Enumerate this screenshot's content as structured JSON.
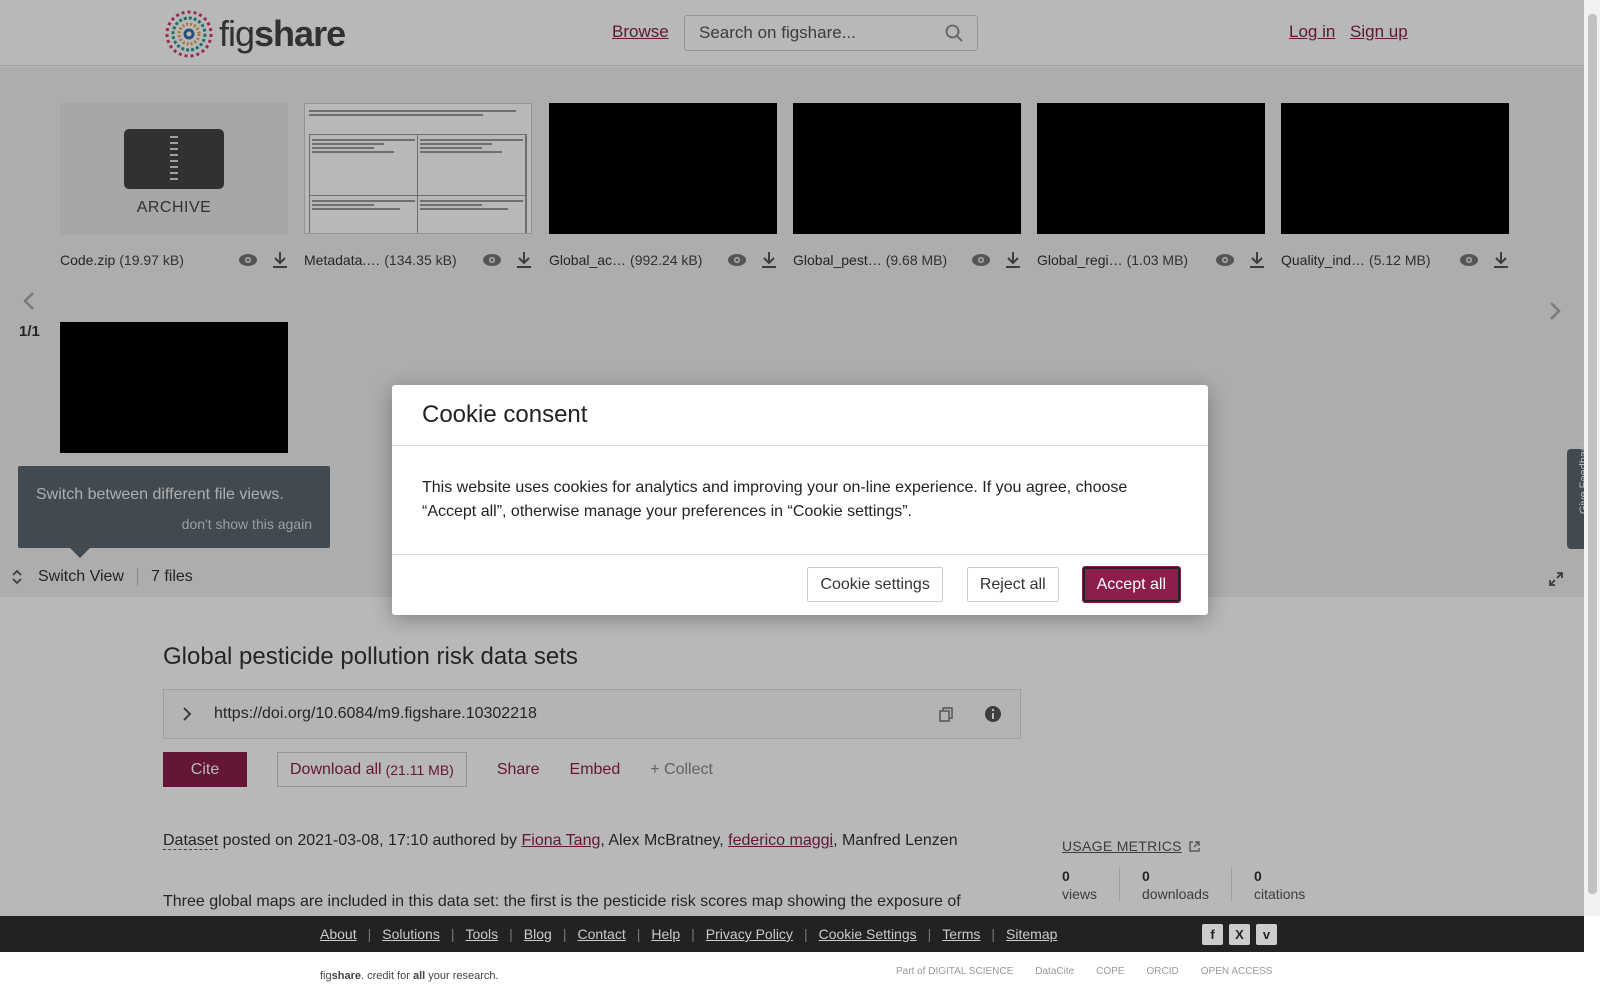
{
  "header": {
    "logo_text_a": "fig",
    "logo_text_b": "share",
    "browse": "Browse",
    "search_placeholder": "Search on figshare...",
    "login": "Log in",
    "signup": "Sign up"
  },
  "viewer": {
    "files": [
      {
        "name": "Code.zip",
        "size": "(19.97 kB)",
        "thumb": "archive",
        "label": "ARCHIVE"
      },
      {
        "name": "Metadata.…",
        "size": "(134.35 kB)",
        "thumb": "doc"
      },
      {
        "name": "Global_ac…",
        "size": "(992.24 kB)",
        "thumb": "black"
      },
      {
        "name": "Global_pest…",
        "size": "(9.68 MB)",
        "thumb": "black"
      },
      {
        "name": "Global_regi…",
        "size": "(1.03 MB)",
        "thumb": "black"
      },
      {
        "name": "Quality_ind…",
        "size": "(5.12 MB)",
        "thumb": "black"
      }
    ],
    "pager": "1/1",
    "tooltip_message": "Switch between different file views.",
    "tooltip_dismiss": "don't show this again",
    "switch_view": "Switch View",
    "file_count": "7 files"
  },
  "item": {
    "title": "Global pesticide pollution risk data sets",
    "doi": "https://doi.org/10.6084/m9.figshare.10302218",
    "cite": "Cite",
    "download_all": "Download all",
    "download_size": "(21.11 MB)",
    "share": "Share",
    "embed": "Embed",
    "collect": "+ Collect",
    "posted_type": "Dataset",
    "posted_text": " posted on 2021-03-08, 17:10 authored by ",
    "authors": [
      "Fiona Tang",
      "Alex McBratney",
      "federico maggi",
      "Manfred Lenzen"
    ],
    "description": "Three global maps are included in this data set: the first is the pesticide risk scores map showing the exposure of"
  },
  "metrics": {
    "title": "USAGE METRICS",
    "items": [
      {
        "value": "0",
        "label": "views"
      },
      {
        "value": "0",
        "label": "downloads"
      },
      {
        "value": "0",
        "label": "citations"
      }
    ]
  },
  "footer": {
    "links": [
      "About",
      "Solutions",
      "Tools",
      "Blog",
      "Contact",
      "Help",
      "Privacy Policy",
      "Cookie Settings",
      "Terms",
      "Sitemap"
    ],
    "tagline_a": "fig",
    "tagline_b": "share",
    "tagline_c": ". credit for ",
    "tagline_d": "all",
    "tagline_e": " your research.",
    "partners": [
      "Part of DIGITAL SCIENCE",
      "DataCite",
      "COPE",
      "ORCID",
      "OPEN ACCESS"
    ]
  },
  "feedback": "Give Feedback",
  "modal": {
    "title": "Cookie consent",
    "body": "This website uses cookies for analytics and improving your on-line experience. If you agree, choose “Accept all”, otherwise manage your preferences in “Cookie settings”.",
    "settings": "Cookie settings",
    "reject": "Reject all",
    "accept": "Accept all"
  },
  "colors": {
    "brand": "#8d1e4c",
    "tooltip": "#5b6770"
  }
}
